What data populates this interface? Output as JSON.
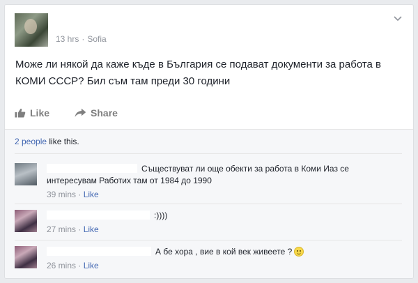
{
  "post": {
    "time": "13 hrs",
    "separator": "·",
    "location": "Sofia",
    "text": "Може ли някой да каже къде в България се подават документи за работа в КОМИ СССР? Бил съм там преди 30 години",
    "like_label": "Like",
    "share_label": "Share",
    "likes_count": "2 people",
    "likes_suffix": " like this."
  },
  "comments": [
    {
      "text": "Съществуват ли още обекти за работа в Коми Иаз се интересувам Работих там от 1984 до 1990",
      "time": "39 mins",
      "separator": "·",
      "like_label": "Like"
    },
    {
      "text": ":))))",
      "time": "27 mins",
      "separator": "·",
      "like_label": "Like"
    },
    {
      "text": "А бе хора , вие в кой век живеете ?",
      "time": "26 mins",
      "separator": "·",
      "like_label": "Like"
    }
  ],
  "icons": {
    "menu": "chevron-down-icon",
    "like": "thumbs-up-icon",
    "share": "share-arrow-icon",
    "emoji": "smiley-emoji-icon"
  },
  "colors": {
    "link": "#4267b2",
    "meta": "#90949c",
    "text": "#1d2129",
    "comment_bg": "#f6f7f9"
  }
}
